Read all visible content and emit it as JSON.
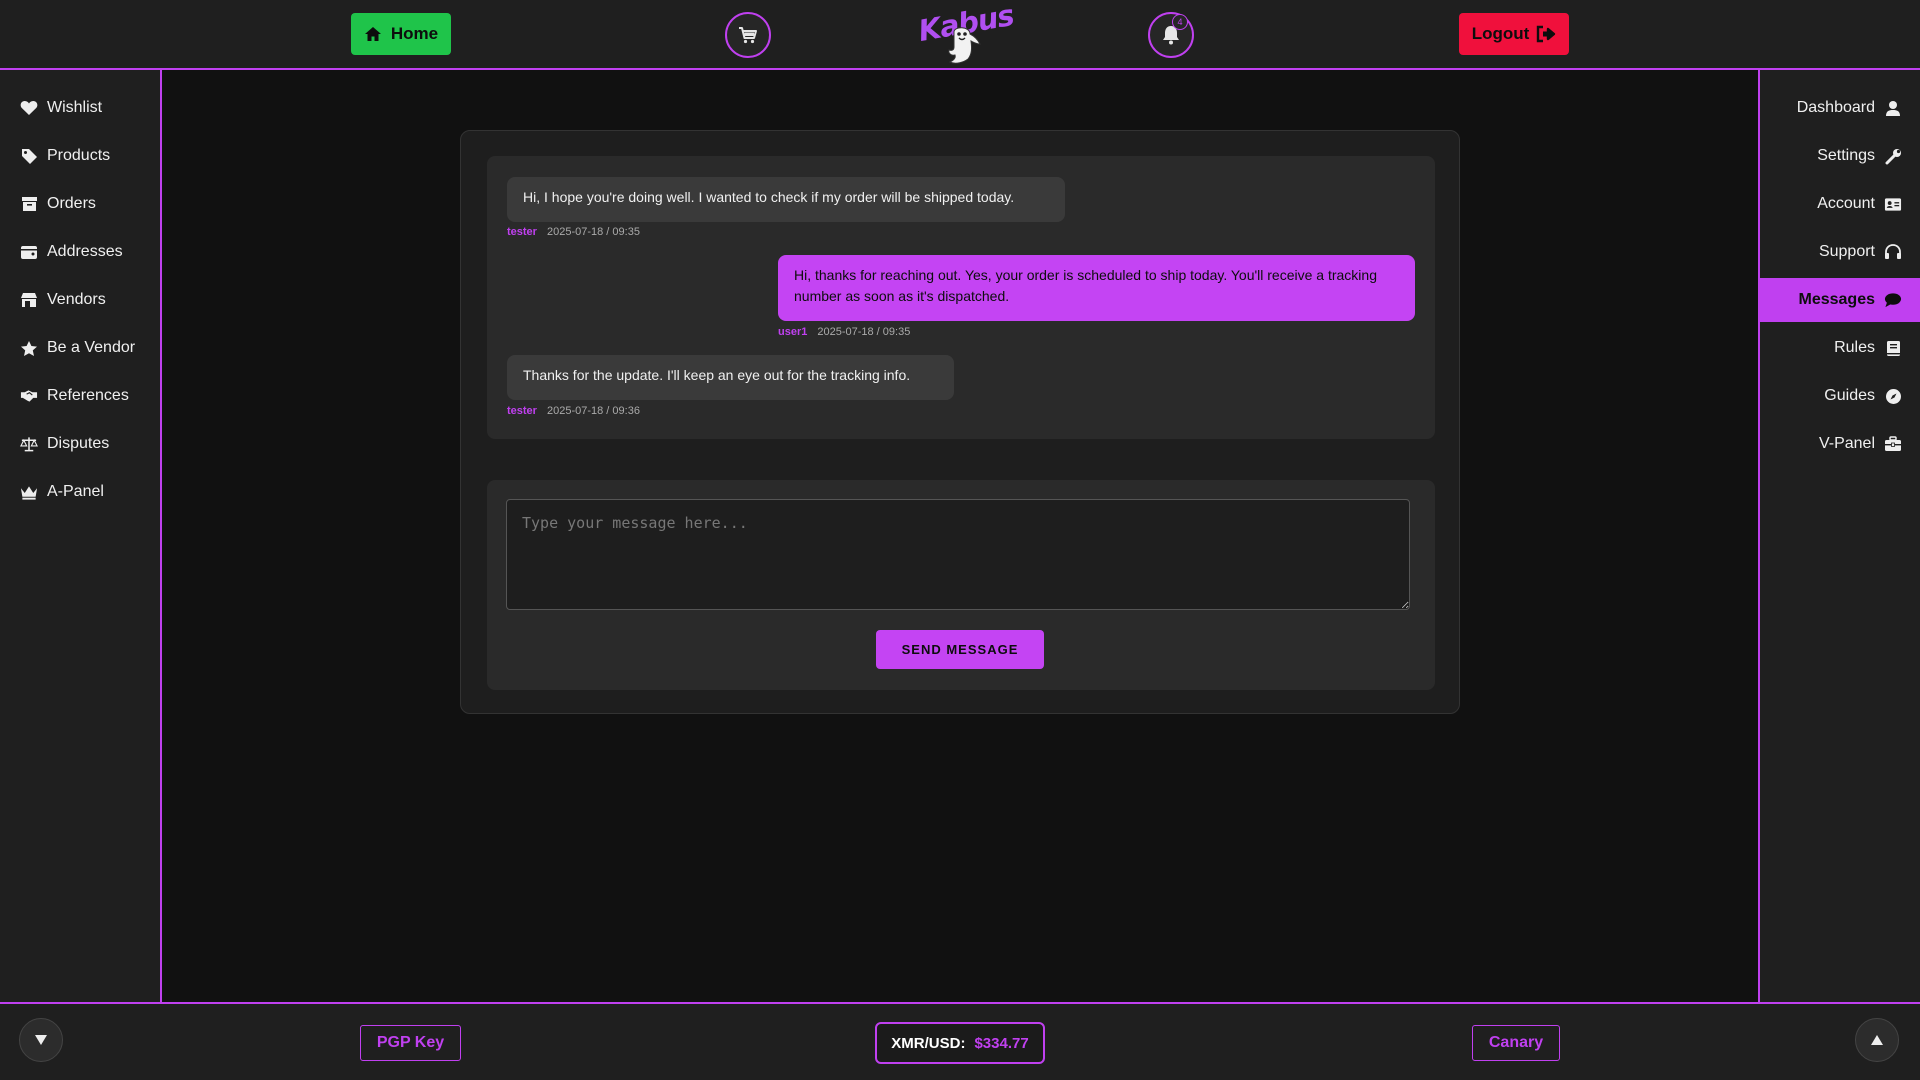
{
  "header": {
    "home_label": "Home",
    "logo_text": "Kabus",
    "notification_count": "4",
    "logout_label": "Logout"
  },
  "sidebar_left": {
    "items": [
      {
        "label": "Wishlist",
        "icon": "heart-icon"
      },
      {
        "label": "Products",
        "icon": "tag-icon"
      },
      {
        "label": "Orders",
        "icon": "box-icon"
      },
      {
        "label": "Addresses",
        "icon": "wallet-icon"
      },
      {
        "label": "Vendors",
        "icon": "store-icon"
      },
      {
        "label": "Be a Vendor",
        "icon": "star-icon"
      },
      {
        "label": "References",
        "icon": "handshake-icon"
      },
      {
        "label": "Disputes",
        "icon": "scale-icon"
      },
      {
        "label": "A-Panel",
        "icon": "crown-icon"
      }
    ]
  },
  "sidebar_right": {
    "items": [
      {
        "label": "Dashboard",
        "icon": "user-icon"
      },
      {
        "label": "Settings",
        "icon": "wrench-icon"
      },
      {
        "label": "Account",
        "icon": "id-card-icon"
      },
      {
        "label": "Support",
        "icon": "headset-icon"
      },
      {
        "label": "Messages",
        "icon": "comment-icon",
        "active": true
      },
      {
        "label": "Rules",
        "icon": "book-icon"
      },
      {
        "label": "Guides",
        "icon": "compass-icon"
      },
      {
        "label": "V-Panel",
        "icon": "briefcase-icon"
      }
    ]
  },
  "chat": {
    "messages": [
      {
        "direction": "incoming",
        "text": "Hi, I hope you're doing well. I wanted to check if my order will be shipped today.",
        "sender": "tester",
        "timestamp": "2025-07-18 / 09:35"
      },
      {
        "direction": "outgoing",
        "text": "Hi, thanks for reaching out. Yes, your order is scheduled to ship today. You'll receive a tracking number as soon as it's dispatched.",
        "sender": "user1",
        "timestamp": "2025-07-18 / 09:35"
      },
      {
        "direction": "incoming",
        "text": "Thanks for the update. I'll keep an eye out for the tracking info.",
        "sender": "tester",
        "timestamp": "2025-07-18 / 09:36"
      }
    ],
    "input_placeholder": "Type your message here...",
    "input_value": "",
    "send_label": "SEND MESSAGE"
  },
  "footer": {
    "pgp_label": "PGP Key",
    "price_label": "XMR/USD:",
    "price_value": "$334.77",
    "canary_label": "Canary"
  },
  "colors": {
    "accent": "#c040f0",
    "home_green": "#1fc44a",
    "logout_red": "#f0103c",
    "background": "#111111",
    "panel": "#1f1f1f"
  }
}
